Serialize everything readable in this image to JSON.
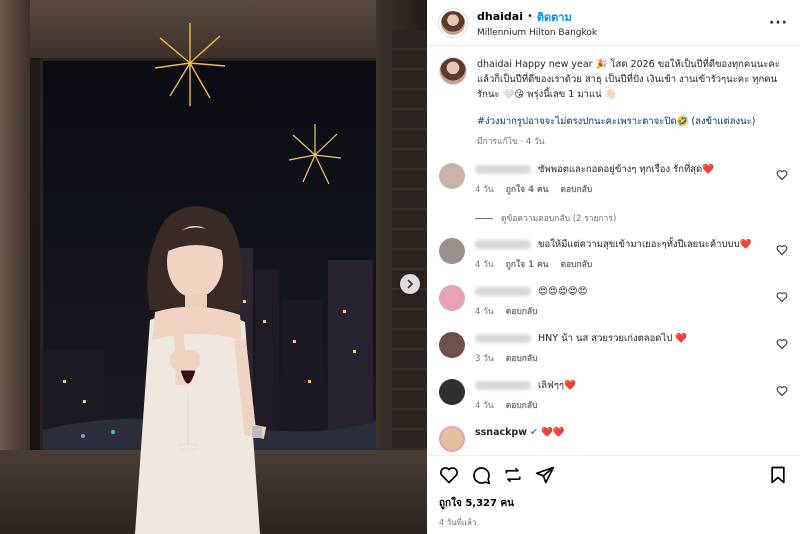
{
  "post": {
    "username": "dhaidai",
    "follow_label": "ติดตาม",
    "location": "Millennium Hilton Bangkok",
    "more_icon": "more-horizontal-icon"
  },
  "caption": {
    "username": "dhaidai",
    "text": "Happy new year 🎉 โสด 2026 ขอให้เป็นปีที่ดีของทุกคนนะคะ แล้วก็เป็นปีที่ดีของเราด้วย สาธุ เป็นปีที่ปัง เงินเข้า งานเข้ารัวๆนะคะ ทุกคน รักนะ 🤍😘 พรุ่งนี้เลข 1 มาแน่ 👋🏻",
    "hashtag": "#ง่วงมากรูปอาจจะไม่ตรงปกนะคะเพราะตาจะปิด🤣 (ลงข้าแต่ลงนะ)",
    "meta": "มีการแก้ไข · 4 วัน"
  },
  "comments": [
    {
      "text": "ซัพพอตและกอดอยู่ข้างๆ ทุกเรื่อง รักที่สุด❤️",
      "time": "4 วัน",
      "likes": "ถูกใจ 4 คน",
      "reply": "ตอบกลับ",
      "avatar_color": "#c9b3a6"
    },
    {
      "text": "ขอให้มีแต่ความสุขเข้ามาเยอะๆทั้งปีเลยนะค้าบบบ❤️",
      "time": "4 วัน",
      "likes": "ถูกใจ 1 คน",
      "reply": "ตอบกลับ",
      "avatar_color": "#9a8f8a"
    },
    {
      "text": "😍😍😍😍😍",
      "time": "4 วัน",
      "likes": "",
      "reply": "ตอบกลับ",
      "avatar_color": "#e7a2b5"
    },
    {
      "text": "HNY น้า นส สวยรวยเก่งตลอดไป ❤️",
      "time": "3 วัน",
      "likes": "",
      "reply": "ตอบกลับ",
      "avatar_color": "#6f5149"
    },
    {
      "text": "เลิฟๆๆ❤️",
      "time": "4 วัน",
      "likes": "",
      "reply": "ตอบกลับ",
      "avatar_color": "#2e2e2e"
    },
    {
      "username": "ssnackpw",
      "text": "❤️❤️",
      "avatar_color": "#e3c09e"
    }
  ],
  "replies": {
    "label": "ดูข้อความตอบกลับ (2 รายการ)"
  },
  "footer": {
    "likes": "ถูกใจ 5,327 คน",
    "time": "4 วันที่แล้ว"
  },
  "colors": {
    "accent": "#0095f6",
    "heart": "#ed1c24",
    "muted": "#737373"
  }
}
